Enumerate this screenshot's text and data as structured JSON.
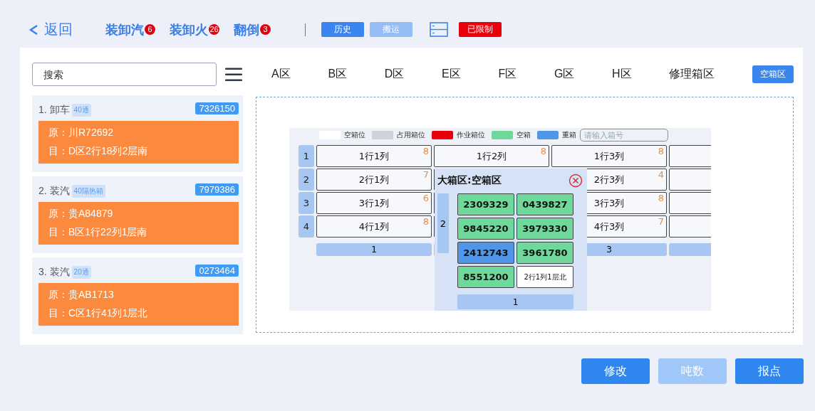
{
  "topbar": {
    "back_label": "返回",
    "tabs": [
      {
        "label": "装卸汽",
        "count": "6"
      },
      {
        "label": "装卸火",
        "count": "26"
      },
      {
        "label": "翻倒",
        "count": "3"
      }
    ],
    "buttons": [
      {
        "kind": "primary",
        "label": "历史",
        "disabled": false
      },
      {
        "kind": "primary",
        "label": "搬运",
        "disabled": true
      },
      {
        "kind": "icon"
      },
      {
        "kind": "danger",
        "label": "已限制",
        "disabled": false
      }
    ]
  },
  "search": {
    "placeholder": "搜索"
  },
  "tasks": [
    {
      "title": "1. 卸车",
      "tag": "40通",
      "number": "7326150",
      "origin": "原：川R72692",
      "target": "目：D区2行18列2层南"
    },
    {
      "title": "2. 装汽",
      "tag": "40隔热箱",
      "number": "7979386",
      "origin": "原：贵A84879",
      "target": "目：B区1行22列1层南"
    },
    {
      "title": "3. 装汽",
      "tag": "20通",
      "number": "0273464",
      "origin": "原：贵AB1713",
      "target": "目：C区1行41列1层北"
    }
  ],
  "zones": [
    {
      "label": "A区",
      "selected": false
    },
    {
      "label": "B区",
      "selected": false
    },
    {
      "label": "D区",
      "selected": false
    },
    {
      "label": "E区",
      "selected": false
    },
    {
      "label": "F区",
      "selected": false
    },
    {
      "label": "G区",
      "selected": false
    },
    {
      "label": "H区",
      "selected": false
    },
    {
      "label": "修理箱区",
      "selected": false
    },
    {
      "label": "空箱区",
      "selected": true
    }
  ],
  "yard": {
    "legend": [
      {
        "label": "空箱位",
        "color": "#ffffff"
      },
      {
        "label": "占用箱位",
        "color": "#cfd2d8"
      },
      {
        "label": "作业箱位",
        "color": "#e8000b"
      },
      {
        "label": "空箱",
        "color": "#6fd99b"
      },
      {
        "label": "重箱",
        "color": "#4f95e8"
      }
    ],
    "box_search": {
      "placeholder": "请输入箱号"
    },
    "lanes": [
      {
        "label": "1",
        "slots": [
          {
            "kind": "slot",
            "text": "1行1列",
            "count": "8"
          },
          {
            "kind": "slot",
            "text": "1行2列",
            "count": "8"
          },
          {
            "kind": "slot",
            "text": "1行3列",
            "count": "8"
          },
          {
            "kind": "blank"
          }
        ]
      },
      {
        "label": "2",
        "slots": [
          {
            "kind": "slot",
            "text": "2行1列",
            "count": "7"
          },
          {
            "kind": "blank"
          },
          {
            "kind": "slot",
            "text": "2行3列",
            "count": "4"
          },
          {
            "kind": "blank"
          }
        ]
      },
      {
        "label": "3",
        "slots": [
          {
            "kind": "slot",
            "text": "3行1列",
            "count": "6"
          },
          {
            "kind": "blank"
          },
          {
            "kind": "slot",
            "text": "3行3列",
            "count": "8"
          },
          {
            "kind": "blank"
          }
        ]
      },
      {
        "label": "4",
        "slots": [
          {
            "kind": "slot",
            "text": "4行1列",
            "count": "8"
          },
          {
            "kind": "blank"
          },
          {
            "kind": "slot",
            "text": "4行3列",
            "count": "7"
          },
          {
            "kind": "blank"
          }
        ]
      }
    ],
    "columns": [
      {
        "kind": "label",
        "text": "1"
      },
      {
        "kind": "blank"
      },
      {
        "kind": "label",
        "text": "3"
      },
      {
        "kind": "blank"
      }
    ],
    "popup": {
      "title": "大箱区:空箱区",
      "row_label": "2",
      "column_label": "1",
      "boxes": [
        {
          "kind": "container",
          "text": "2309329",
          "color": "#6fd99b"
        },
        {
          "kind": "container",
          "text": "0439827",
          "color": "#6fd99b"
        },
        {
          "kind": "container",
          "text": "9845220",
          "color": "#6fd99b"
        },
        {
          "kind": "container",
          "text": "3979330",
          "color": "#6fd99b"
        },
        {
          "kind": "container",
          "text": "2412743",
          "color": "#4f95e8"
        },
        {
          "kind": "container",
          "text": "3961780",
          "color": "#6fd99b"
        },
        {
          "kind": "container",
          "text": "8551200",
          "color": "#6fd99b"
        },
        {
          "kind": "slot",
          "text": "2行1列1层北",
          "color": "#ffffff"
        }
      ]
    }
  },
  "actions": [
    {
      "label": "修改",
      "disabled": false
    },
    {
      "label": "吨数",
      "disabled": true
    },
    {
      "label": "报点",
      "disabled": false
    }
  ]
}
